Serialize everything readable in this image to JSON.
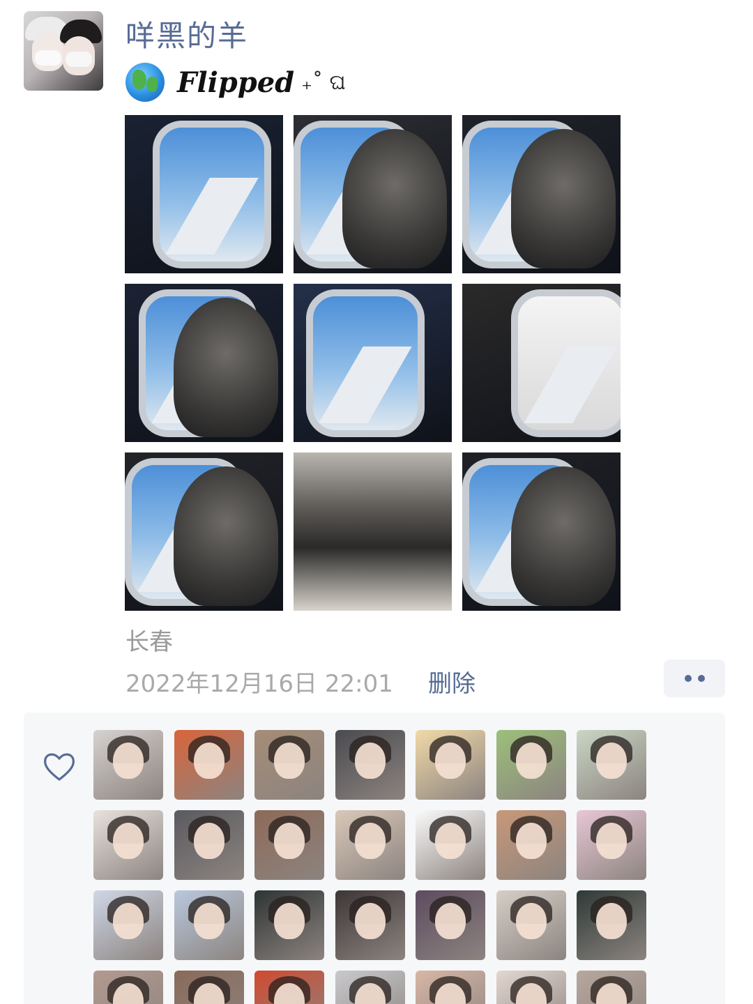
{
  "post": {
    "username": "咩黑的羊",
    "caption_icon": "earth-globe-icon",
    "caption_text": "Flipped",
    "caption_decoration": "₊˚ ଘ",
    "photos": [
      {
        "icon": "airplane-window-wing-photo",
        "tone": "#1a2233"
      },
      {
        "icon": "person-in-hat-window-photo",
        "tone": "#2c2e33"
      },
      {
        "icon": "person-peace-sign-photo",
        "tone": "#1f2329"
      },
      {
        "icon": "phone-selfie-window-photo",
        "tone": "#1b2233"
      },
      {
        "icon": "wing-sky-window-photo",
        "tone": "#24304a"
      },
      {
        "icon": "hands-bright-window-photo",
        "tone": "#2b2a2a"
      },
      {
        "icon": "person-in-hat-wing-photo",
        "tone": "#222428"
      },
      {
        "icon": "cabin-seat-pocket-photo",
        "tone": "#3a3a3a"
      },
      {
        "icon": "person-neck-pillow-photo",
        "tone": "#1f2126"
      }
    ],
    "location": "长春",
    "timestamp": "2022年12月16日 22:01",
    "delete_label": "删除"
  },
  "likes": {
    "icon": "heart-outline-icon",
    "accent": "#576b95",
    "avatars": [
      {
        "tone": "#d6d2cf"
      },
      {
        "tone": "#d9643a"
      },
      {
        "tone": "#a58c76"
      },
      {
        "tone": "#4a4a4f"
      },
      {
        "tone": "#f1d9a8"
      },
      {
        "tone": "#9cc07a"
      },
      {
        "tone": "#c9d6c4"
      },
      {
        "tone": "#e7e2dc"
      },
      {
        "tone": "#5a5a5f"
      },
      {
        "tone": "#8d6a58"
      },
      {
        "tone": "#d9c8b8"
      },
      {
        "tone": "#fbfbfb"
      },
      {
        "tone": "#c89878"
      },
      {
        "tone": "#e8c7d5"
      },
      {
        "tone": "#cfd7e6"
      },
      {
        "tone": "#b9c8dc"
      },
      {
        "tone": "#2e3434"
      },
      {
        "tone": "#3c3636"
      },
      {
        "tone": "#5d4b5f"
      },
      {
        "tone": "#d7cfc6"
      },
      {
        "tone": "#2e3a36"
      },
      {
        "tone": "#b39a8f"
      },
      {
        "tone": "#8a6a5a"
      },
      {
        "tone": "#d04a30"
      },
      {
        "tone": "#c9c9cc"
      },
      {
        "tone": "#d8b6a6"
      },
      {
        "tone": "#e3d7d0"
      },
      {
        "tone": "#b7a79d"
      }
    ]
  }
}
